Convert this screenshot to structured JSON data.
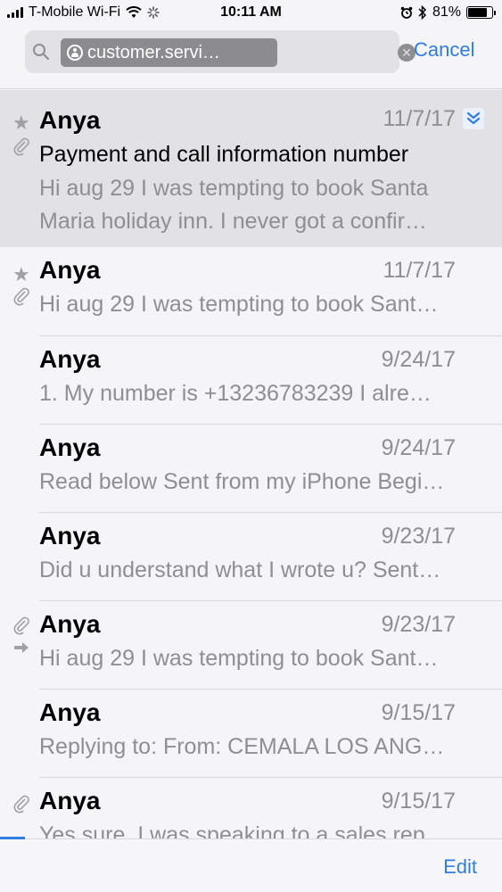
{
  "status_bar": {
    "carrier": "T-Mobile Wi-Fi",
    "time": "10:11 AM",
    "battery_text": "81%",
    "battery_level": 0.81
  },
  "search": {
    "token_label": "customer.servi…",
    "cancel_label": "Cancel"
  },
  "messages": [
    {
      "sender": "Anya",
      "date": "11/7/17",
      "subject": "Payment and call information number",
      "preview": "Hi aug 29 I was tempting to book Santa Maria holiday inn. I never got a confir…",
      "starred": true,
      "attachment": true,
      "selected": true
    },
    {
      "sender": "Anya",
      "date": "11/7/17",
      "preview": "Hi aug 29 I was tempting to book Sant…",
      "starred": true,
      "attachment": true
    },
    {
      "sender": "Anya",
      "date": "9/24/17",
      "preview": "1. My number is +13236783239 I alre…"
    },
    {
      "sender": "Anya",
      "date": "9/24/17",
      "preview": "Read below Sent from my iPhone Begi…"
    },
    {
      "sender": "Anya",
      "date": "9/23/17",
      "preview": "Did u understand what I wrote u? Sent…"
    },
    {
      "sender": "Anya",
      "date": "9/23/17",
      "preview": "Hi aug 29 I was tempting to book Sant…",
      "attachment": true,
      "forwarded": true
    },
    {
      "sender": "Anya",
      "date": "9/15/17",
      "preview": "Replying to: From: CEMALA LOS ANG…"
    },
    {
      "sender": "Anya",
      "date": "9/15/17",
      "preview": "Yes sure. I was speaking to a sales rep…",
      "attachment": true
    }
  ],
  "toolbar": {
    "edit_label": "Edit"
  },
  "colors": {
    "accent": "#2f7de0",
    "selected_row": "#e1e1e6",
    "secondary_text": "#8e8e93"
  },
  "icons": [
    "wifi-icon",
    "loading-icon",
    "alarm-icon",
    "bluetooth-icon",
    "battery-icon",
    "search-icon",
    "person-icon",
    "clear-icon",
    "star-icon",
    "attachment-icon",
    "forward-icon",
    "thread-expand-icon"
  ]
}
